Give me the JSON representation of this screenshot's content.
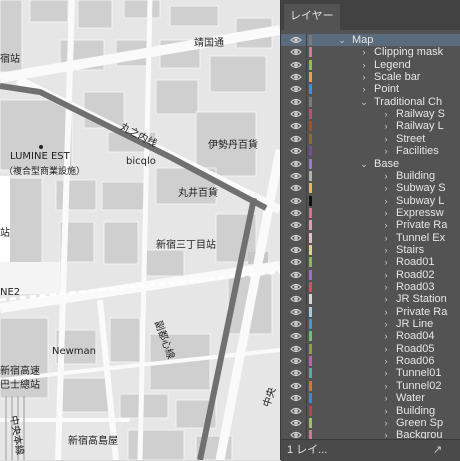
{
  "map": {
    "labels": [
      {
        "name": "label-yasukuni-dori",
        "text": "靖国通"
      },
      {
        "name": "label-shinjuku-station-partial",
        "text": "宿站"
      },
      {
        "name": "label-lumine-est",
        "text": "LUMINE EST"
      },
      {
        "name": "label-lumine-est-sub",
        "text": "（複合型商業設施）"
      },
      {
        "name": "label-marunouchi-line",
        "text": "丸之内线"
      },
      {
        "name": "label-isetan",
        "text": "伊勢丹百貨"
      },
      {
        "name": "label-bicqlo",
        "text": "bicqlo"
      },
      {
        "name": "label-marui",
        "text": "丸井百貨"
      },
      {
        "name": "label-shinjuku-sanchome",
        "text": "新宿三丁目站"
      },
      {
        "name": "label-ne2-partial",
        "text": "NE2"
      },
      {
        "name": "label-fuku-line",
        "text": "副都心線"
      },
      {
        "name": "label-newman",
        "text": "Newman"
      },
      {
        "name": "label-bus-terminal-1",
        "text": "新宿高速"
      },
      {
        "name": "label-bus-terminal-2",
        "text": "巴士總站"
      },
      {
        "name": "label-chuo-line",
        "text": "中央本線"
      },
      {
        "name": "label-takashimaya",
        "text": "新宿高島屋"
      },
      {
        "name": "label-partial-left",
        "text": "站"
      },
      {
        "name": "label-partial-right",
        "text": "中央"
      }
    ]
  },
  "panel": {
    "tab_title": "レイヤー",
    "footer_text": "1 レイ...",
    "footer_icon": "new-layer-icon",
    "layers": [
      {
        "label": "Map",
        "indent": 0,
        "expanded": true,
        "color": "#7a7a7a",
        "selected": true
      },
      {
        "label": "Clipping mask",
        "indent": 1,
        "expanded": false,
        "color": "#d47a95"
      },
      {
        "label": "Legend",
        "indent": 1,
        "expanded": false,
        "color": "#8bc34a"
      },
      {
        "label": "Scale bar",
        "indent": 1,
        "expanded": false,
        "color": "#e8a33a"
      },
      {
        "label": "Point",
        "indent": 1,
        "expanded": false,
        "color": "#3a8fe8"
      },
      {
        "label": "Traditional Ch",
        "indent": 1,
        "expanded": true,
        "color": "#7a7a7a"
      },
      {
        "label": "Railway S",
        "indent": 2,
        "expanded": false,
        "color": "#c44a7a"
      },
      {
        "label": "Railway L",
        "indent": 2,
        "expanded": false,
        "color": "#a0522d"
      },
      {
        "label": "Street",
        "indent": 2,
        "expanded": false,
        "color": "#8a6a3a"
      },
      {
        "label": "Facilities",
        "indent": 2,
        "expanded": false,
        "color": "#7a4a9a"
      },
      {
        "label": "Base",
        "indent": 1,
        "expanded": true,
        "color": "#9a7ac4"
      },
      {
        "label": "Building",
        "indent": 2,
        "expanded": false,
        "color": "#b0b0b0"
      },
      {
        "label": "Subway S",
        "indent": 2,
        "expanded": false,
        "color": "#e0c040"
      },
      {
        "label": "Subway L",
        "indent": 2,
        "expanded": false,
        "color": "#111111"
      },
      {
        "label": "Expressw",
        "indent": 2,
        "expanded": false,
        "color": "#e86a8a"
      },
      {
        "label": "Private Ra",
        "indent": 2,
        "expanded": false,
        "color": "#d8a0b0"
      },
      {
        "label": "Tunnel Ex",
        "indent": 2,
        "expanded": false,
        "color": "#e8c0c8"
      },
      {
        "label": "Stairs",
        "indent": 2,
        "expanded": false,
        "color": "#e8d090"
      },
      {
        "label": "Road01",
        "indent": 2,
        "expanded": false,
        "color": "#8ab860"
      },
      {
        "label": "Road02",
        "indent": 2,
        "expanded": false,
        "color": "#a070c0"
      },
      {
        "label": "Road03",
        "indent": 2,
        "expanded": false,
        "color": "#d05060"
      },
      {
        "label": "JR Station",
        "indent": 2,
        "expanded": false,
        "color": "#d8d8d8"
      },
      {
        "label": "Private Ra",
        "indent": 2,
        "expanded": false,
        "color": "#a0d0e0"
      },
      {
        "label": "JR Line",
        "indent": 2,
        "expanded": false,
        "color": "#4a90e0"
      },
      {
        "label": "Road04",
        "indent": 2,
        "expanded": false,
        "color": "#70c070"
      },
      {
        "label": "Road05",
        "indent": 2,
        "expanded": false,
        "color": "#90a040"
      },
      {
        "label": "Road06",
        "indent": 2,
        "expanded": false,
        "color": "#c060b0"
      },
      {
        "label": "Tunnel01",
        "indent": 2,
        "expanded": false,
        "color": "#50b0a0"
      },
      {
        "label": "Tunnel02",
        "indent": 2,
        "expanded": false,
        "color": "#e07030"
      },
      {
        "label": "Water",
        "indent": 2,
        "expanded": false,
        "color": "#4a80e0"
      },
      {
        "label": "Building",
        "indent": 2,
        "expanded": false,
        "color": "#c04050"
      },
      {
        "label": "Green Sp",
        "indent": 2,
        "expanded": false,
        "color": "#a0c070"
      },
      {
        "label": "Backgrou",
        "indent": 2,
        "expanded": false,
        "color": "#c87890"
      }
    ]
  }
}
